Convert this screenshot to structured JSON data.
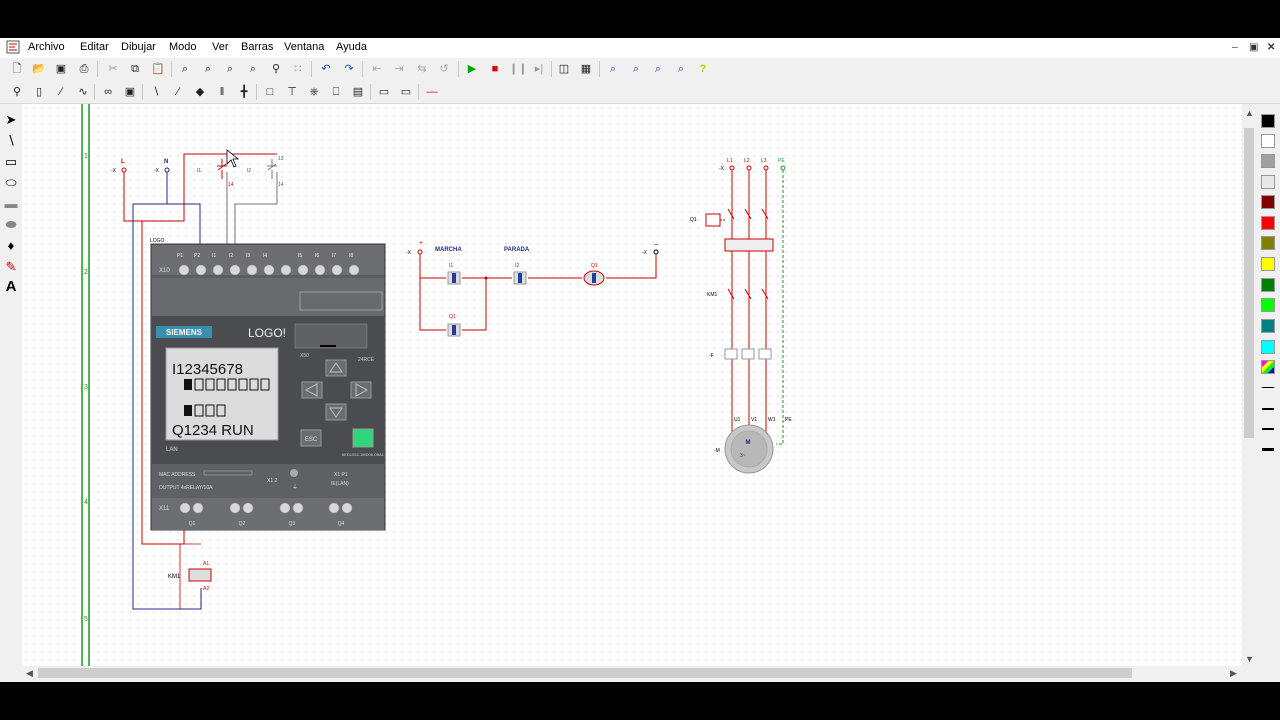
{
  "menu": {
    "items": [
      "Archivo",
      "Editar",
      "Dibujar",
      "Modo",
      "Ver",
      "Barras",
      "Ventana",
      "Ayuda"
    ]
  },
  "toolbar1": [
    "new-icon",
    "open-icon",
    "save-icon",
    "print-icon",
    "cut-icon",
    "copy-icon",
    "paste-icon",
    "zoom-window-icon",
    "zoom-area-icon",
    "zoom-fit-icon",
    "zoom-select-icon",
    "find-icon",
    "grid-icon",
    "undo-icon",
    "redo-icon",
    "align-left-icon",
    "align-right-icon",
    "flip-icon",
    "rotate-icon",
    "play-icon",
    "stop-icon",
    "pause-icon",
    "step-icon",
    "monitor-icon",
    "network-icon",
    "zoom-in-icon",
    "zoom-out-icon",
    "zoom-plus-icon",
    "zoom-minus-icon",
    "help-icon"
  ],
  "toolbar2": [
    "lamp-icon",
    "fuse-icon",
    "contact-icon",
    "resistor-icon",
    "coil-icon",
    "transformer-icon",
    "switch-no-icon",
    "switch-nc-icon",
    "diode-icon",
    "capacitor-icon",
    "relay-icon",
    "terminal-icon",
    "connector-icon",
    "timer-icon",
    "counter-icon",
    "plc-icon",
    "display-icon",
    "wire-icon"
  ],
  "left_tools": [
    "pointer-icon",
    "line-icon",
    "rectangle-icon",
    "ellipse-icon",
    "filled-rectangle-icon",
    "filled-ellipse-icon",
    "fill-icon",
    "pen-icon",
    "text-icon"
  ],
  "palette": {
    "colors": [
      "#000000",
      "#ffffff",
      "#a0a0a0",
      "#e8e8e8",
      "#800000",
      "#ff0000",
      "#808000",
      "#ffff00",
      "#008000",
      "#00ff00",
      "#008080",
      "#00ffff"
    ]
  },
  "ruler": {
    "numbers": [
      "1",
      "2",
      "3",
      "4",
      "5"
    ]
  },
  "circuit": {
    "left": {
      "supply": [
        "L",
        "N"
      ],
      "buttons": [
        "I1",
        "I2"
      ],
      "terminal_marks": [
        "-X",
        "-X"
      ],
      "pins_top": [
        "13",
        "14"
      ],
      "pins_mid": [
        "13",
        "14"
      ],
      "logo_tag": "LOGO",
      "coil": {
        "label": "KM1",
        "a1": "A1",
        "a2": "A2"
      }
    },
    "logo": {
      "brand": "SIEMENS",
      "model": "LOGO!",
      "model_code": "24RCE",
      "x10_label": "X10",
      "x11_label": "X11",
      "inputs": [
        "P1",
        "P2",
        "I1",
        "I2",
        "I3",
        "I4",
        "I5",
        "I6",
        "I7",
        "I8"
      ],
      "lcd_line1": "I12345678",
      "lcd_line3": "Q1234 RUN",
      "lan_label": "LAN",
      "x50_label": "X50",
      "esc_label": "ESC",
      "mac_label": "MAC ADDRESS",
      "output_label": "OUTPUT 4xRELAY/10A",
      "x12_label": "X1 2",
      "x1p1_label": "X1 P1",
      "lan_port_label": "IE(LAN)",
      "serial": "6ED1052-1MD08-0BA1",
      "outputs": [
        "Q1",
        "Q2",
        "Q3",
        "Q4"
      ]
    },
    "middle": {
      "plus": "+",
      "minus": "−",
      "labels": [
        "MARCHA",
        "PARADA"
      ],
      "contacts": [
        "I1",
        "I2",
        "Q1"
      ],
      "holding": "Q1",
      "terminal_marks": [
        "-X",
        "-X"
      ]
    },
    "power": {
      "phases": [
        "L1",
        "L2",
        "L3",
        "PE"
      ],
      "breaker": "Q1",
      "contactor": "KM1",
      "relay": "-F",
      "terminals": [
        "U1",
        "V1",
        "W1",
        "PE"
      ],
      "motor": "M",
      "motor_symbol": "3~",
      "motor_tag": "-M",
      "terminal_mark": "-X"
    }
  }
}
